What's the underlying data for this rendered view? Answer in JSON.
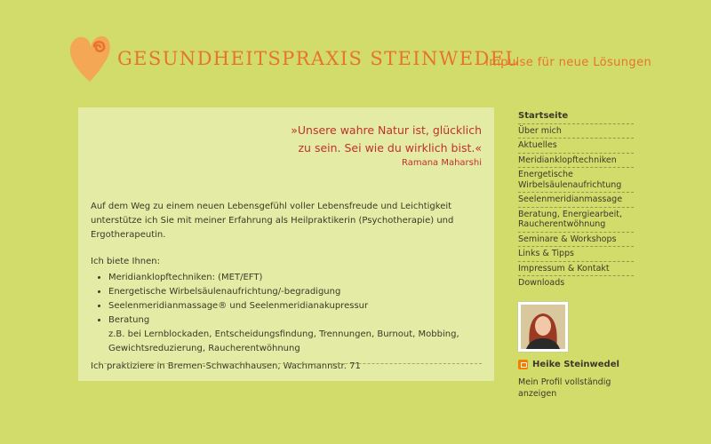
{
  "header": {
    "title": "GESUNDHEITSPRAXIS STEINWEDEL",
    "tagline": "Impulse für neue Lösungen"
  },
  "colors": {
    "background": "#d1dc6b",
    "content_box": "#e3eba4",
    "accent_orange": "#e8732e",
    "quote_red": "#c0322c"
  },
  "quote": {
    "line1": "»Unsere wahre Natur ist, glücklich",
    "line2": "zu sein. Sei wie du wirklich bist.«",
    "author": "Ramana Maharshi"
  },
  "content": {
    "intro": "Auf dem Weg zu einem neuen Lebensgefühl voller Lebensfreude und Leichtigkeit unterstütze ich Sie mit meiner Erfahrung als Heilpraktikerin (Psychotherapie) und Ergotherapeutin.",
    "offer_heading": "Ich biete Ihnen:",
    "offers": [
      "Meridianklopftechniken: (MET/EFT)",
      "Energetische Wirbelsäulenaufrichtung/-begradigung",
      "Seelenmeridianmassage® und Seelenmeridianakupressur",
      "Beratung"
    ],
    "offer_detail": "z.B. bei Lernblockaden, Entscheidungsfindung, Trennungen, Burnout, Mobbing, Gewichtsreduzierung, Raucherentwöhnung",
    "practice": "Ich praktiziere in Bremen-Schwachhausen, Wachmannstr. 71"
  },
  "nav": {
    "items": [
      "Startseite",
      "Über mich",
      "Aktuelles",
      "Meridianklopftechniken",
      "Energetische Wirbelsäulenaufrichtung",
      "Seelenmeridianmassage",
      "Beratung, Energiearbeit, Raucherentwöhnung",
      "Seminare & Workshops",
      "Links & Tipps",
      "Impressum & Kontakt",
      "Downloads"
    ]
  },
  "profile": {
    "name": "Heike Steinwedel",
    "link": "Mein Profil vollständig anzeigen",
    "icon": "blogger-icon"
  }
}
